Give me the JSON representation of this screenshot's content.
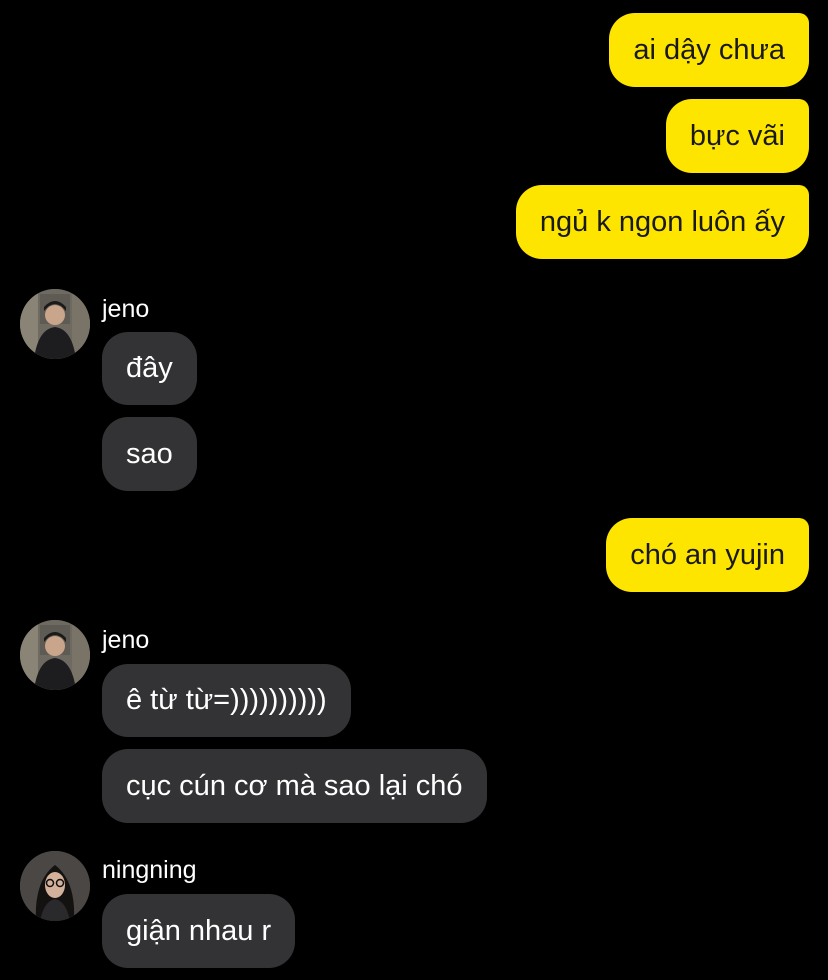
{
  "chat": {
    "outgoing_1": "ai dậy chưa",
    "outgoing_2": "bực vãi",
    "outgoing_3": "ngủ k ngon luôn ấy",
    "group_1": {
      "sender": "jeno",
      "messages": [
        "đây",
        "sao"
      ]
    },
    "outgoing_4": "chó an yujin",
    "group_2": {
      "sender": "jeno",
      "messages": [
        "ê từ từ=))))))))))",
        "cục cún cơ mà sao lại chó"
      ]
    },
    "group_3": {
      "sender": "ningning",
      "messages": [
        "giận nhau r"
      ]
    }
  },
  "colors": {
    "background": "#000000",
    "outgoing_bubble": "#FEE500",
    "incoming_bubble": "#333335",
    "outgoing_text": "#191919",
    "incoming_text": "#FFFFFF"
  },
  "icons": {
    "avatar_jeno": "avatar-photo",
    "avatar_ningning": "avatar-photo"
  }
}
